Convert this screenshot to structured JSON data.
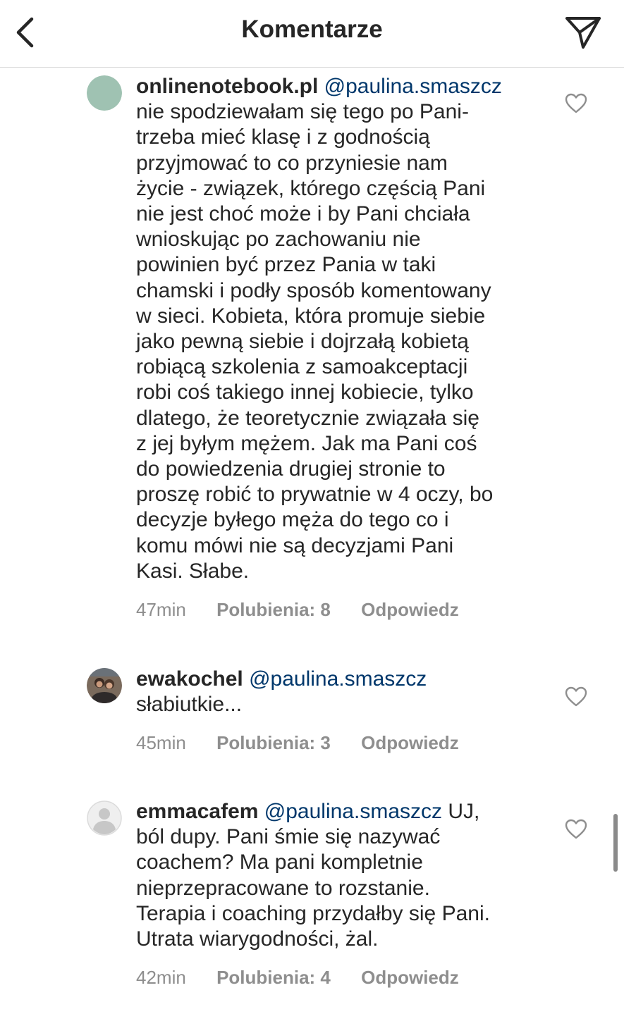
{
  "header": {
    "title": "Komentarze",
    "back_icon": "chevron-left-icon",
    "send_icon": "paper-plane-icon"
  },
  "comments": [
    {
      "username": "onlinenotebook.pl",
      "mention": "@paulina.smaszcz",
      "lines": [
        "nie spodziewałam się tego po Pani-",
        "trzeba mieć klasę i z godnością",
        "przyjmować to co przyniesie nam",
        "życie - związek, którego częścią Pani",
        "nie jest choć może i by Pani chciała",
        "wnioskując po zachowaniu nie",
        "powinien być przez Pania w taki",
        "chamski i podły sposób komentowany",
        "w sieci. Kobieta, która promuje siebie",
        "jako pewną siebie i dojrzałą kobietą",
        "robiącą szkolenia z samoakceptacji",
        "robi coś takiego innej kobiecie, tylko",
        "dlatego, że teoretycznie  związała się",
        "z jej byłym mężem. Jak ma Pani coś",
        "do powiedzenia drugiej stronie to",
        "proszę robić to prywatnie w 4 oczy, bo",
        "decyzje byłego męża do tego co i",
        "komu mówi nie są decyzjami Pani",
        "Kasi. Słabe."
      ],
      "time": "47min",
      "likes": "Polubienia: 8",
      "reply": "Odpowiedz",
      "avatar_color": "#9fc2b2"
    },
    {
      "username": "ewakochel",
      "mention": "@paulina.smaszcz",
      "lines": [
        "słabiutkie..."
      ],
      "time": "45min",
      "likes": "Polubienia: 3",
      "reply": "Odpowiedz",
      "avatar_color": "#6b5a4d"
    },
    {
      "username": "emmacafem",
      "mention": "@paulina.smaszcz",
      "first_line_tail": "UJ,",
      "lines": [
        "ból dupy. Pani śmie się nazywać",
        "coachem? Ma pani kompletnie",
        "nieprzepracowane to rozstanie.",
        "Terapia i coaching przydałby się Pani.",
        "Utrata wiarygodności, żal."
      ],
      "time": "42min",
      "likes": "Polubienia: 4",
      "reply": "Odpowiedz",
      "avatar_color": "#e6e6e6"
    }
  ],
  "colors": {
    "text": "#262626",
    "mention": "#00376b",
    "meta": "#8e8e8e",
    "divider": "#dbdbdb"
  }
}
